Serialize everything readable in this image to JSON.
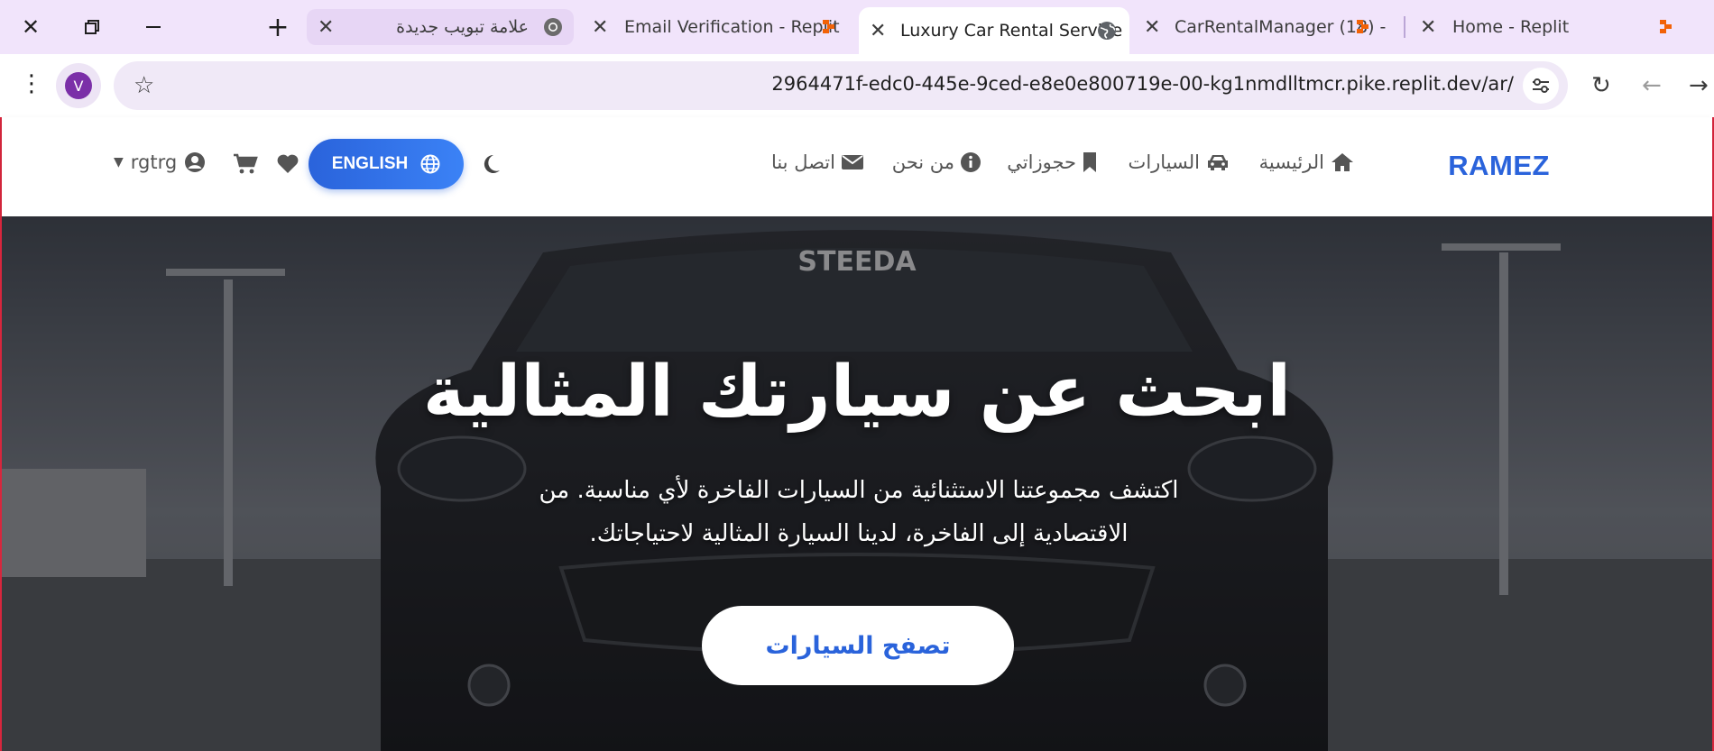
{
  "browser": {
    "tabs": [
      {
        "title": "علامة تبويب جديدة",
        "icon": "chrome-icon",
        "state": "highlighted"
      },
      {
        "title": "Email Verification - Replit",
        "icon": "replit-icon",
        "state": "normal"
      },
      {
        "title": "Luxury Car Rental Service",
        "icon": "globe-icon",
        "state": "active"
      },
      {
        "title": "CarRentalManager (18) -",
        "icon": "replit-icon",
        "state": "normal"
      },
      {
        "title": "Home - Replit",
        "icon": "replit-icon",
        "state": "normal"
      }
    ],
    "profile_initial": "V",
    "url": "2964471f-edc0-445e-9ced-e8e0e800719e-00-kg1nmdlltmcr.pike.replit.dev/ar/"
  },
  "site": {
    "brand": "RAMEZ",
    "nav": [
      {
        "label": "الرئيسية",
        "icon": "home-icon"
      },
      {
        "label": "السيارات",
        "icon": "car-icon"
      },
      {
        "label": "حجوزاتي",
        "icon": "bookmark-icon"
      },
      {
        "label": "من نحن",
        "icon": "info-icon"
      },
      {
        "label": "اتصل بنا",
        "icon": "envelope-icon"
      }
    ],
    "language_button": "ENGLISH",
    "user_name": "rgtrg",
    "icons": [
      "moon-icon",
      "globe-icon",
      "heart-icon",
      "cart-icon",
      "user-circle-icon",
      "caret-down-icon"
    ]
  },
  "hero": {
    "title": "ابحث عن سيارتك المثالية",
    "subtitle": "اكتشف مجموعتنا الاستثنائية من السيارات الفاخرة لأي مناسبة. من الاقتصادية إلى الفاخرة، لدينا السيارة المثالية لاحتياجاتك.",
    "cta": "تصفح السيارات",
    "windshield_text": "STEEDA"
  },
  "colors": {
    "accent": "#2a63db",
    "tabstrip": "#f1e4fb",
    "omnibox": "#f0e9f7",
    "replit": "#f26207"
  }
}
